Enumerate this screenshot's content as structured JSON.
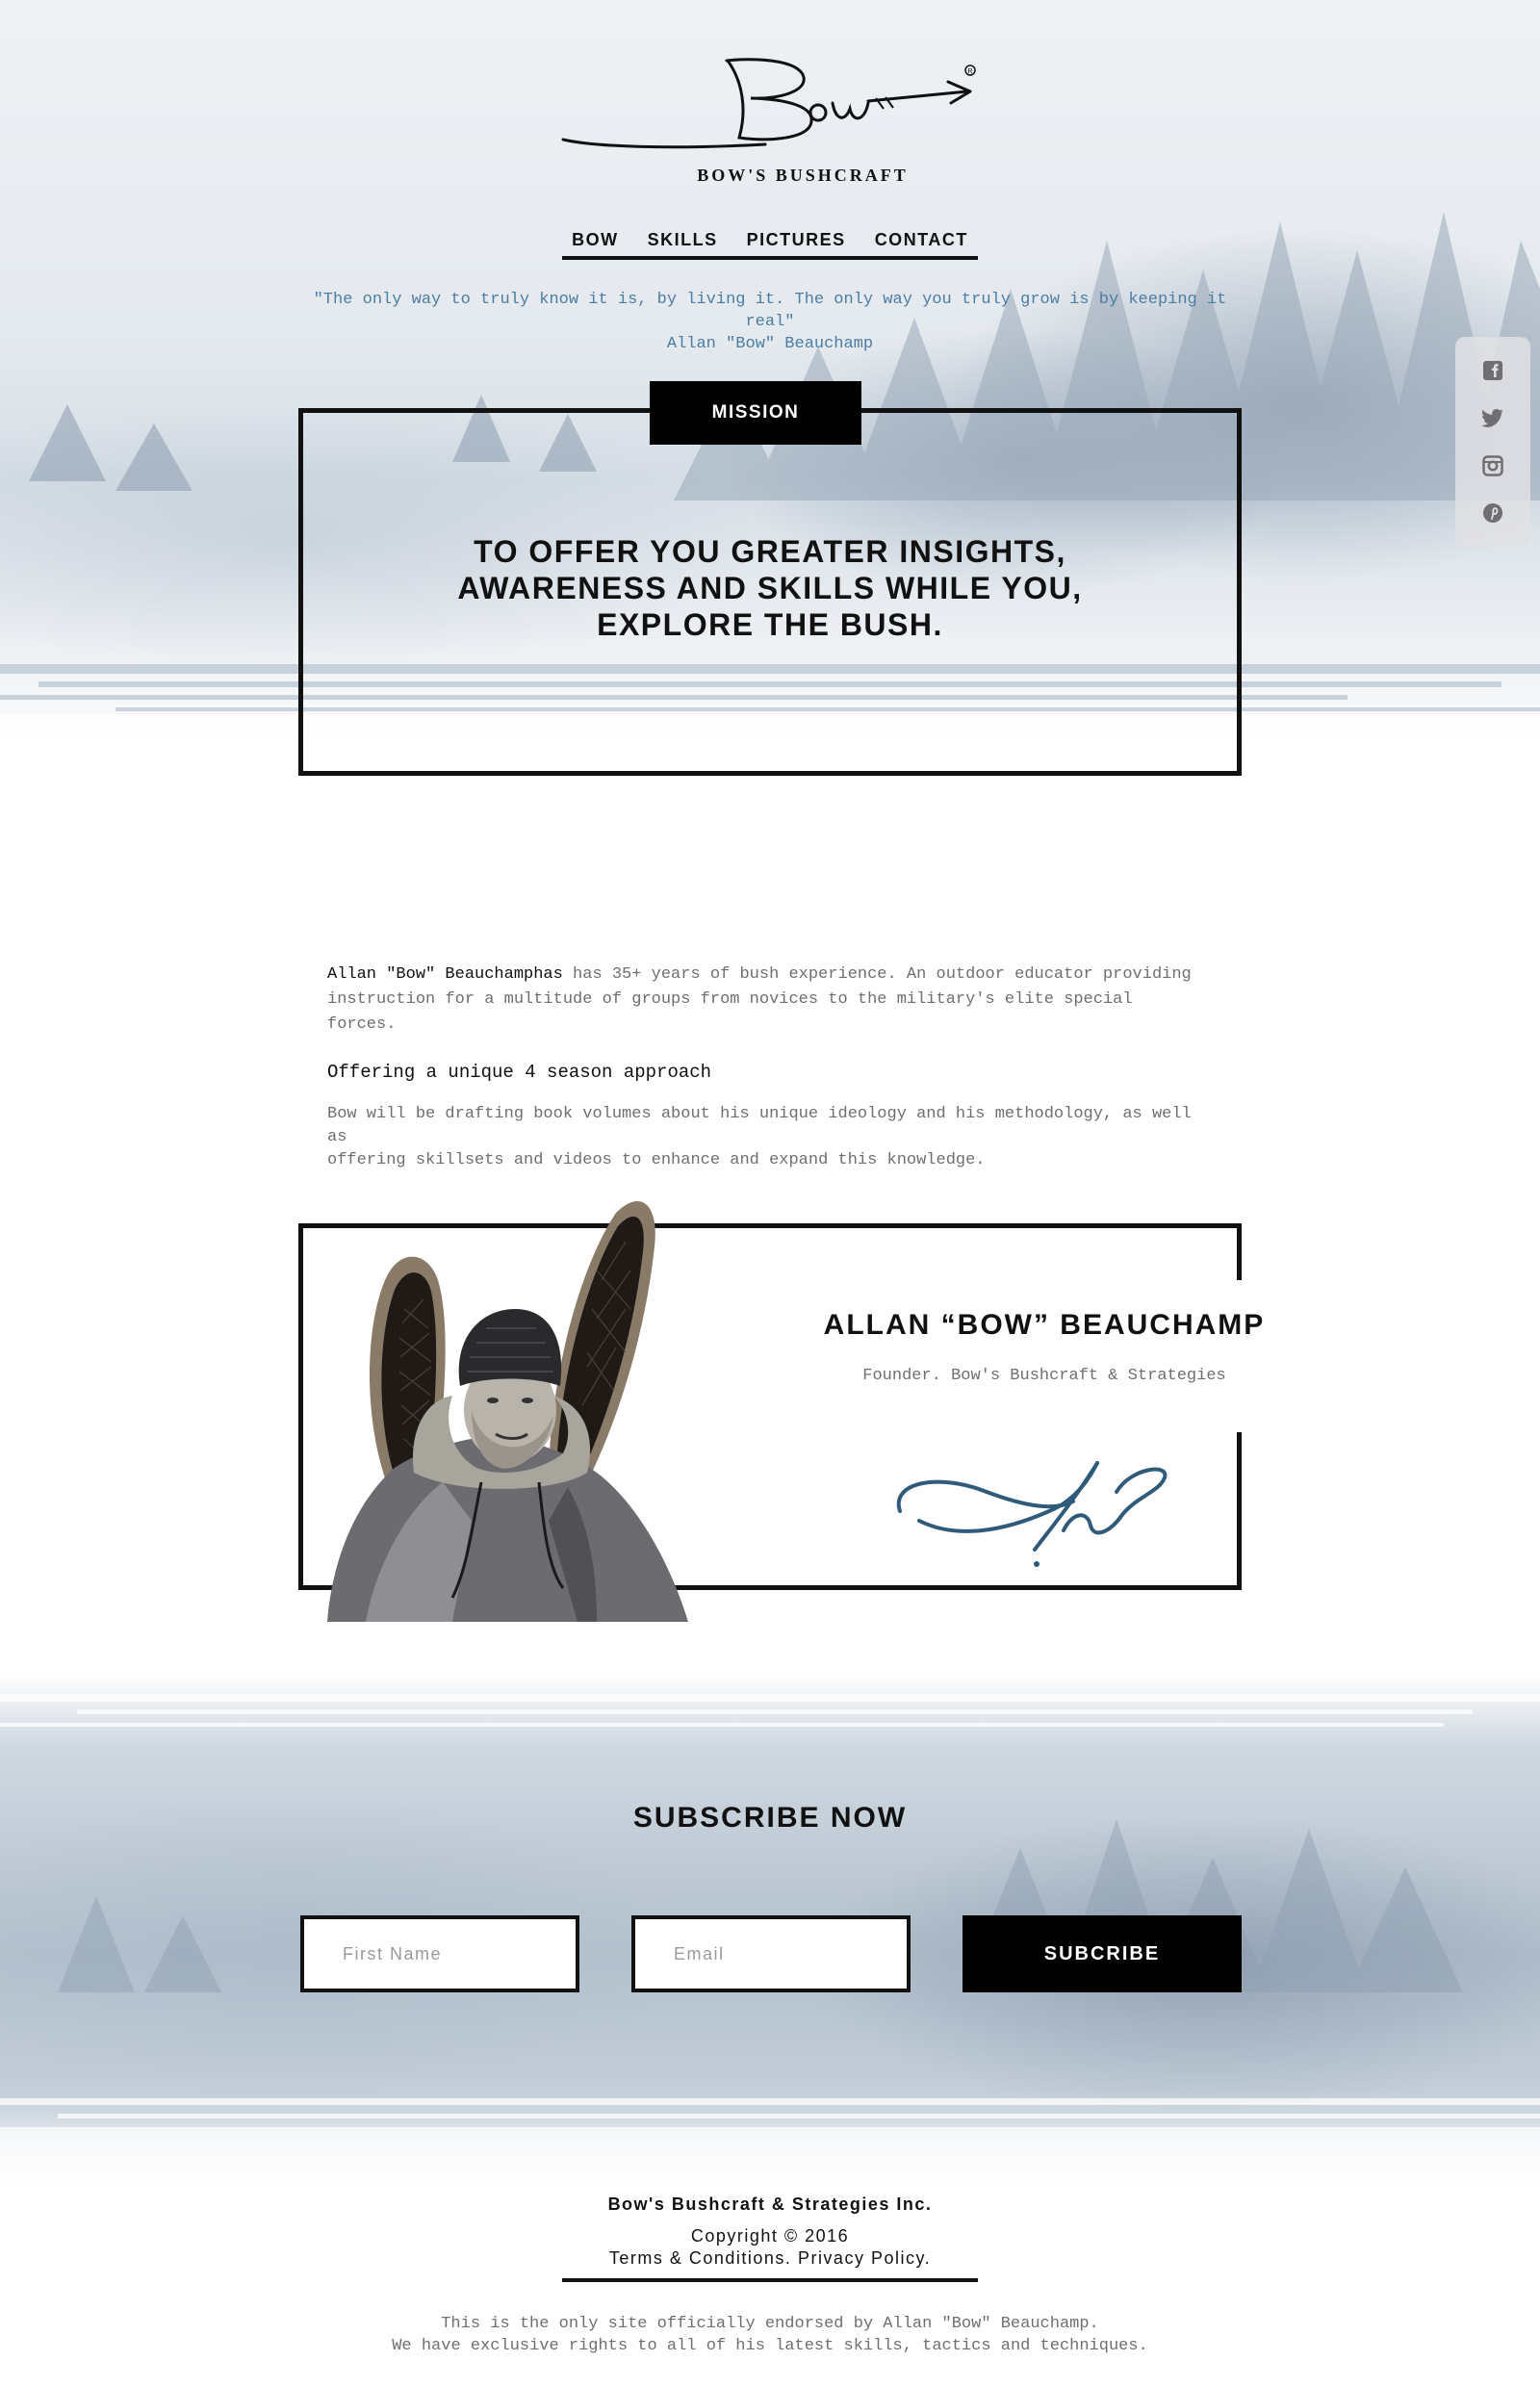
{
  "logo": {
    "script_text": "Bow",
    "brand_name": "BOW'S BUSHCRAFT"
  },
  "nav": {
    "items": [
      {
        "label": "BOW"
      },
      {
        "label": "SKILLS"
      },
      {
        "label": "PICTURES"
      },
      {
        "label": "CONTACT"
      }
    ]
  },
  "quote": {
    "text": "\"The only way to truly know it is, by living it. The only way you truly grow is by keeping it real\"",
    "author": "Allan \"Bow\" Beauchamp"
  },
  "social": {
    "icons": [
      "facebook-icon",
      "twitter-icon",
      "instagram-icon",
      "pinterest-icon"
    ]
  },
  "mission": {
    "tab_label": "MISSION",
    "lines": [
      "TO OFFER YOU GREATER INSIGHTS,",
      "AWARENESS AND SKILLS WHILE YOU,",
      "EXPLORE THE BUSH."
    ]
  },
  "about": {
    "name": "Allan \"Bow\" Beauchamphas",
    "intro_line1_rest": " has 35+ years of bush experience. An outdoor educator providing",
    "intro_line2": "instruction for a multitude of groups from novices to the military's elite special forces.",
    "heading": "Offering a unique 4 season approach",
    "body_line1": "Bow will be drafting book volumes about his unique ideology and his methodology, as well as",
    "body_line2": "offering skillsets and videos to enhance and expand this knowledge."
  },
  "founder": {
    "name": "ALLAN “BOW” BEAUCHAMP",
    "title": "Founder. Bow's Bushcraft & Strategies"
  },
  "subscribe": {
    "title": "SUBSCRIBE NOW",
    "first_name_placeholder": "First Name",
    "email_placeholder": "Email",
    "button_label": "SUBCRIBE"
  },
  "footer": {
    "company": "Bow's Bushcraft & Strategies Inc.",
    "copyright": "Copyright © 2016",
    "terms": "Terms & Conditions.",
    "privacy": "Privacy Policy.",
    "note_line1": "This is the only site officially endorsed by Allan \"Bow\" Beauchamp.",
    "note_line2": "We have exclusive rights to all of his latest skills, tactics and techniques."
  },
  "colors": {
    "quote_blue": "#4d7da3",
    "signature_blue": "#2f5a7a",
    "ink": "#111111",
    "muted_text": "#6f6f6f"
  }
}
